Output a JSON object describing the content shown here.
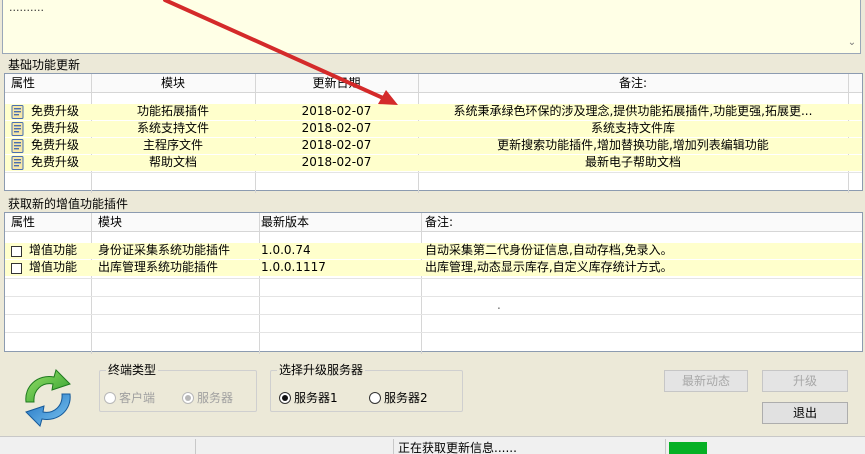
{
  "top_panel": {
    "dots": ".........."
  },
  "basic_updates": {
    "section_title": "基础功能更新",
    "columns": [
      "属性",
      "模块",
      "更新日期",
      "备注:"
    ],
    "rows": [
      {
        "attr": "免费升级",
        "module": "功能拓展插件",
        "date": "2018-02-07",
        "note": "系统秉承绿色环保的涉及理念,提供功能拓展插件,功能更强,拓展更..."
      },
      {
        "attr": "免费升级",
        "module": "系统支持文件",
        "date": "2018-02-07",
        "note": "系统支持文件库"
      },
      {
        "attr": "免费升级",
        "module": "主程序文件",
        "date": "2018-02-07",
        "note": "更新搜索功能插件,增加替换功能,增加列表编辑功能"
      },
      {
        "attr": "免费升级",
        "module": "帮助文档",
        "date": "2018-02-07",
        "note": "最新电子帮助文档"
      }
    ]
  },
  "addon_plugins": {
    "section_title": "获取新的增值功能插件",
    "columns": [
      "属性",
      "模块",
      "最新版本",
      "备注:"
    ],
    "rows": [
      {
        "attr": "增值功能",
        "module": "身份证采集系统功能插件",
        "version": "1.0.0.74",
        "note": "自动采集第二代身份证信息,自动存档,免录入。"
      },
      {
        "attr": "增值功能",
        "module": "出库管理系统功能插件",
        "version": "1.0.0.1117",
        "note": "出库管理,动态显示库存,自定义库存统计方式。"
      }
    ],
    "stray_mark": "."
  },
  "terminal_type": {
    "title": "终端类型",
    "options": [
      "客户端",
      "服务器"
    ],
    "selected": "服务器"
  },
  "server_select": {
    "title": "选择升级服务器",
    "options": [
      "服务器1",
      "服务器2"
    ],
    "selected": "服务器1"
  },
  "buttons": {
    "news": "最新动态",
    "upgrade": "升级",
    "exit": "退出"
  },
  "status": {
    "text": "正在获取更新信息......",
    "progress_percent": 20
  },
  "colors": {
    "accent_red": "#d42a2a",
    "row_yellow": "#ffffcc",
    "progress_green": "#06b025"
  },
  "icons": {
    "module_icon": "document-icon",
    "refresh_icon": "green-blue-refresh-arrows-icon"
  }
}
